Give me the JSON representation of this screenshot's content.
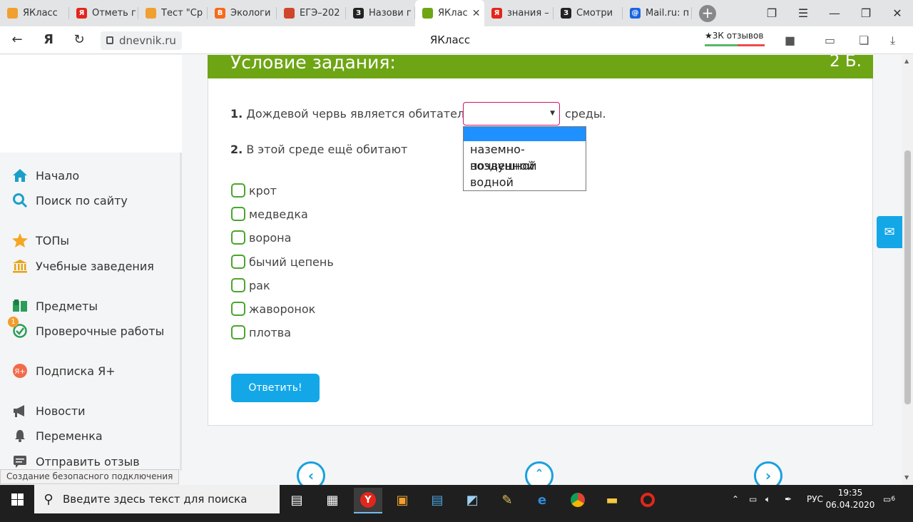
{
  "tabs": [
    {
      "title": "ЯКласс",
      "color": "#f0a030",
      "glyph": ""
    },
    {
      "title": "Отметь г",
      "color": "#e2261c",
      "glyph": "Я"
    },
    {
      "title": "Тест \"Ср",
      "color": "#f0a030",
      "glyph": ""
    },
    {
      "title": "Экологи",
      "color": "#f56a1c",
      "glyph": "B"
    },
    {
      "title": "ЕГЭ–202",
      "color": "#d0462a",
      "glyph": ""
    },
    {
      "title": "Назови г",
      "color": "#222222",
      "glyph": "З"
    },
    {
      "title": "ЯКлас",
      "color": "#6ea514",
      "glyph": "",
      "active": true
    },
    {
      "title": "знания –",
      "color": "#e2261c",
      "glyph": "Я"
    },
    {
      "title": "Смотри",
      "color": "#222222",
      "glyph": "З"
    },
    {
      "title": "Mail.ru: п",
      "color": "#1a64e0",
      "glyph": "@"
    }
  ],
  "address": {
    "url": "dnevnik.ru",
    "page_title": "ЯКласс",
    "reviews": "3К отзывов"
  },
  "sidebar": {
    "items": [
      {
        "label": "Начало",
        "icon": "home-icon"
      },
      {
        "label": "Поиск по сайту",
        "icon": "search-icon"
      },
      {
        "label": "ТОПы",
        "icon": "star-icon"
      },
      {
        "label": "Учебные заведения",
        "icon": "school-icon"
      },
      {
        "label": "Предметы",
        "icon": "book-icon"
      },
      {
        "label": "Проверочные работы",
        "icon": "check-icon",
        "badge": "1"
      },
      {
        "label": "Подписка Я+",
        "icon": "subscription-icon"
      },
      {
        "label": "Новости",
        "icon": "megaphone-icon"
      },
      {
        "label": "Переменка",
        "icon": "bell-icon"
      },
      {
        "label": "Отправить отзыв",
        "icon": "feedback-icon"
      }
    ]
  },
  "task": {
    "header": "Условие задания:",
    "points": "2 Б.",
    "q1_num": "1.",
    "q1_text": "Дождевой червь является обитателем",
    "q1_suffix": "среды.",
    "q2_num": "2.",
    "q2_text": "В этой среде ещё обитают",
    "dropdown_options": [
      "",
      "наземно-воздушной",
      "почвенной",
      "водной"
    ],
    "checkboxes": [
      "крот",
      "медведка",
      "ворона",
      "бычий цепень",
      "рак",
      "жаворонок",
      "плотва"
    ],
    "submit": "Ответить!"
  },
  "status": "Создание безопасного подключения",
  "taskbar": {
    "search_placeholder": "Введите здесь текст для поиска",
    "lang": "РУС",
    "time": "19:35",
    "date": "06.04.2020",
    "notif_count": "6"
  }
}
